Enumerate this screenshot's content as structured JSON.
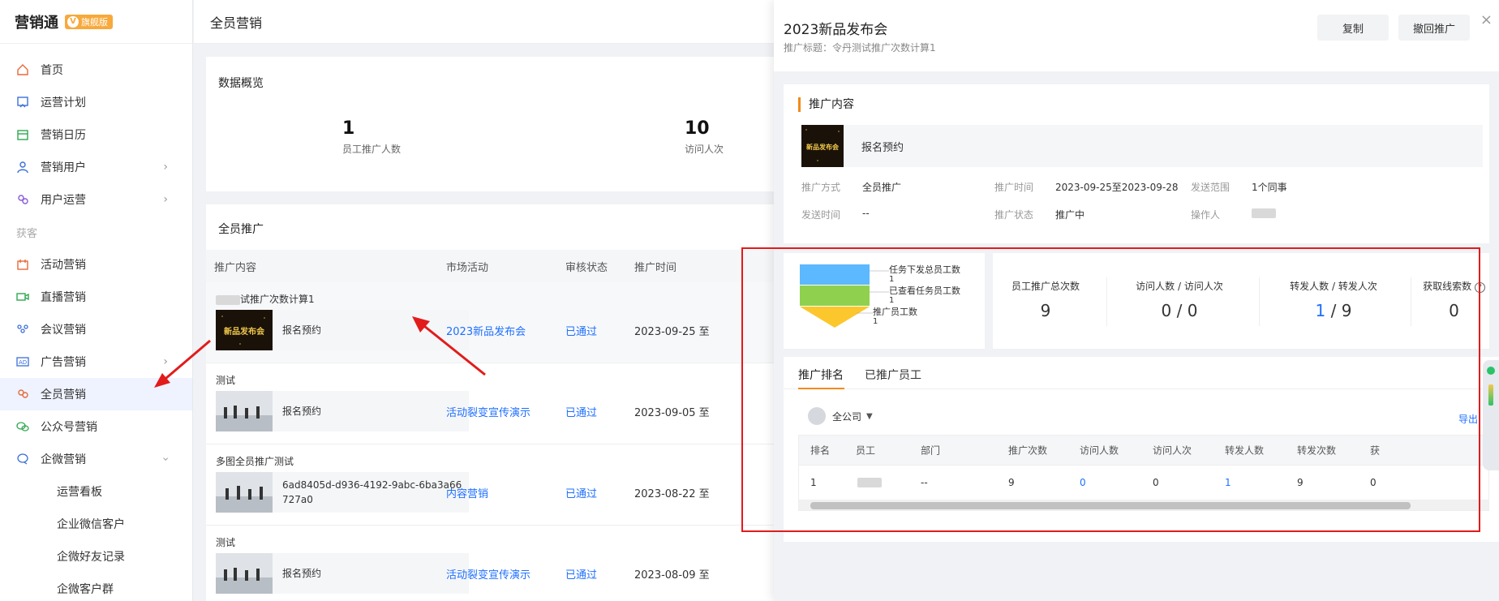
{
  "brand": {
    "name": "营销通",
    "badge": "旗舰版",
    "badge_v": "V"
  },
  "sidebar": {
    "items": [
      {
        "label": "首页"
      },
      {
        "label": "运营计划"
      },
      {
        "label": "营销日历"
      },
      {
        "label": "营销用户"
      },
      {
        "label": "用户运营"
      }
    ],
    "section": "获客",
    "items2": [
      {
        "label": "活动营销"
      },
      {
        "label": "直播营销"
      },
      {
        "label": "会议营销"
      },
      {
        "label": "广告营销"
      },
      {
        "label": "全员营销"
      },
      {
        "label": "公众号营销"
      },
      {
        "label": "企微营销"
      }
    ],
    "sub_items": [
      {
        "label": "运营看板"
      },
      {
        "label": "企业微信客户"
      },
      {
        "label": "企微好友记录"
      },
      {
        "label": "企微客户群"
      }
    ]
  },
  "main": {
    "header": "全员营销",
    "overview": {
      "title": "数据概览",
      "stats": [
        {
          "num": "1",
          "label": "员工推广人数"
        },
        {
          "num": "10",
          "label": "访问人次"
        }
      ]
    },
    "promo": {
      "title": "全员推广",
      "columns": [
        "推广内容",
        "市场活动",
        "审核状态",
        "推广时间"
      ],
      "rows": [
        {
          "title": "试推广次数计算1",
          "media_text": "报名预约",
          "activity": "2023新品发布会",
          "status": "已通过",
          "time": "2023-09-25 至"
        },
        {
          "title": "测试",
          "media_text": "报名预约",
          "activity": "活动裂变宣传演示",
          "status": "已通过",
          "time": "2023-09-05 至"
        },
        {
          "title": "多图全员推广测试",
          "media_text": "6ad8405d-d936-4192-9abc-6ba3a66727a0",
          "activity": "内容营销",
          "status": "已通过",
          "time": "2023-08-22 至"
        },
        {
          "title": "测试",
          "media_text": "报名预约",
          "activity": "活动裂变宣传演示",
          "status": "已通过",
          "time": "2023-08-09 至"
        }
      ],
      "thumb_text": "新品发布会"
    }
  },
  "drawer": {
    "title": "2023新品发布会",
    "subtitle": "推广标题：令丹测试推广次数计算1",
    "copy_btn": "复制",
    "revoke_btn": "撤回推广",
    "close": "×",
    "section_title": "推广内容",
    "content_text": "报名预约",
    "thumb_text": "新品发布会",
    "info": {
      "method_k": "推广方式",
      "method_v": "全员推广",
      "time_k": "推广时间",
      "time_v": "2023-09-25至2023-09-28",
      "range_k": "发送范围",
      "range_v": "1个同事",
      "send_time_k": "发送时间",
      "send_time_v": "--",
      "status_k": "推广状态",
      "status_v": "推广中",
      "operator_k": "操作人"
    },
    "funnel": [
      {
        "label": "任务下发总员工数",
        "value": "1",
        "color": "#5cb8ff"
      },
      {
        "label": "已查看任务员工数",
        "value": "1",
        "color": "#8fd14f"
      },
      {
        "label": "推广员工数",
        "value": "1",
        "color": "#fcc72c"
      }
    ],
    "stats": [
      {
        "label": "员工推广总次数",
        "value": "9"
      },
      {
        "label": "访问人数 / 访问人次",
        "a": "0",
        "b": "0"
      },
      {
        "label": "转发人数 / 转发人次",
        "a": "1",
        "b": "9"
      },
      {
        "label": "获取线索数",
        "value": "0",
        "help": "?"
      }
    ],
    "tabs": [
      "推广排名",
      "已推广员工"
    ],
    "company": "全公司",
    "export": "导出",
    "rank_columns": [
      "排名",
      "员工",
      "部门",
      "推广次数",
      "访问人数",
      "访问人次",
      "转发人数",
      "转发次数",
      "获"
    ],
    "rank_rows": [
      {
        "rank": "1",
        "dept": "--",
        "times": "9",
        "visitors": "0",
        "visits": "0",
        "forwarders": "1",
        "forwards": "9",
        "leads": "0"
      }
    ]
  },
  "colors": {
    "accent": "#1e6fff",
    "orange": "#f08a1c",
    "red_box": "#e21b1b"
  }
}
